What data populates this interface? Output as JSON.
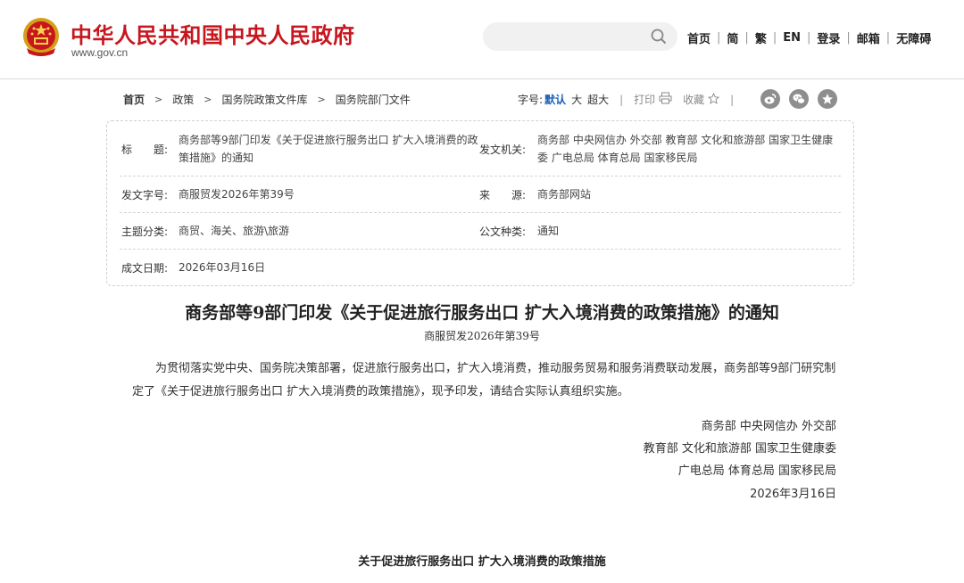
{
  "header": {
    "site_name": "中华人民共和国中央人民政府",
    "site_url": "www.gov.cn",
    "search_placeholder": "",
    "nav": [
      "首页",
      "简",
      "繁",
      "EN",
      "登录",
      "邮箱",
      "无障碍"
    ],
    "brand_color": "#c8161e"
  },
  "breadcrumb": [
    "首页",
    "政策",
    "国务院政策文件库",
    "国务院部门文件"
  ],
  "tools": {
    "font_size_label": "字号:",
    "size_default": "默认",
    "size_large": "大",
    "size_xlarge": "超大",
    "print": "打印",
    "favorite": "收藏",
    "share_icons": [
      "weibo-icon",
      "wechat-icon",
      "star-icon"
    ]
  },
  "info": {
    "title_label": "标　　题:",
    "title_value": "商务部等9部门印发《关于促进旅行服务出口 扩大入境消费的政策措施》的通知",
    "issuer_label": "发文机关:",
    "issuer_value": "商务部 中央网信办 外交部 教育部 文化和旅游部 国家卫生健康委 广电总局 体育总局 国家移民局",
    "docno_label": "发文字号:",
    "docno_value": "商服贸发2026年第39号",
    "source_label": "来　　源:",
    "source_value": "商务部网站",
    "topic_label": "主题分类:",
    "topic_value": "商贸、海关、旅游\\旅游",
    "type_label": "公文种类:",
    "type_value": "通知",
    "date_label": "成文日期:",
    "date_value": "2026年03月16日"
  },
  "article": {
    "title": "商务部等9部门印发《关于促进旅行服务出口 扩大入境消费的政策措施》的通知",
    "doc_no": "商服贸发2026年第39号",
    "body": "为贯彻落实党中央、国务院决策部署，促进旅行服务出口，扩大入境消费，推动服务贸易和服务消费联动发展，商务部等9部门研究制定了《关于促进旅行服务出口 扩大入境消费的政策措施》，现予印发，请结合实际认真组织实施。",
    "signers": [
      "商务部 中央网信办 外交部",
      "教育部 文化和旅游部 国家卫生健康委",
      "广电总局 体育总局 国家移民局"
    ],
    "sign_date": "2026年3月16日",
    "attachment_title": "关于促进旅行服务出口 扩大入境消费的政策措施"
  }
}
